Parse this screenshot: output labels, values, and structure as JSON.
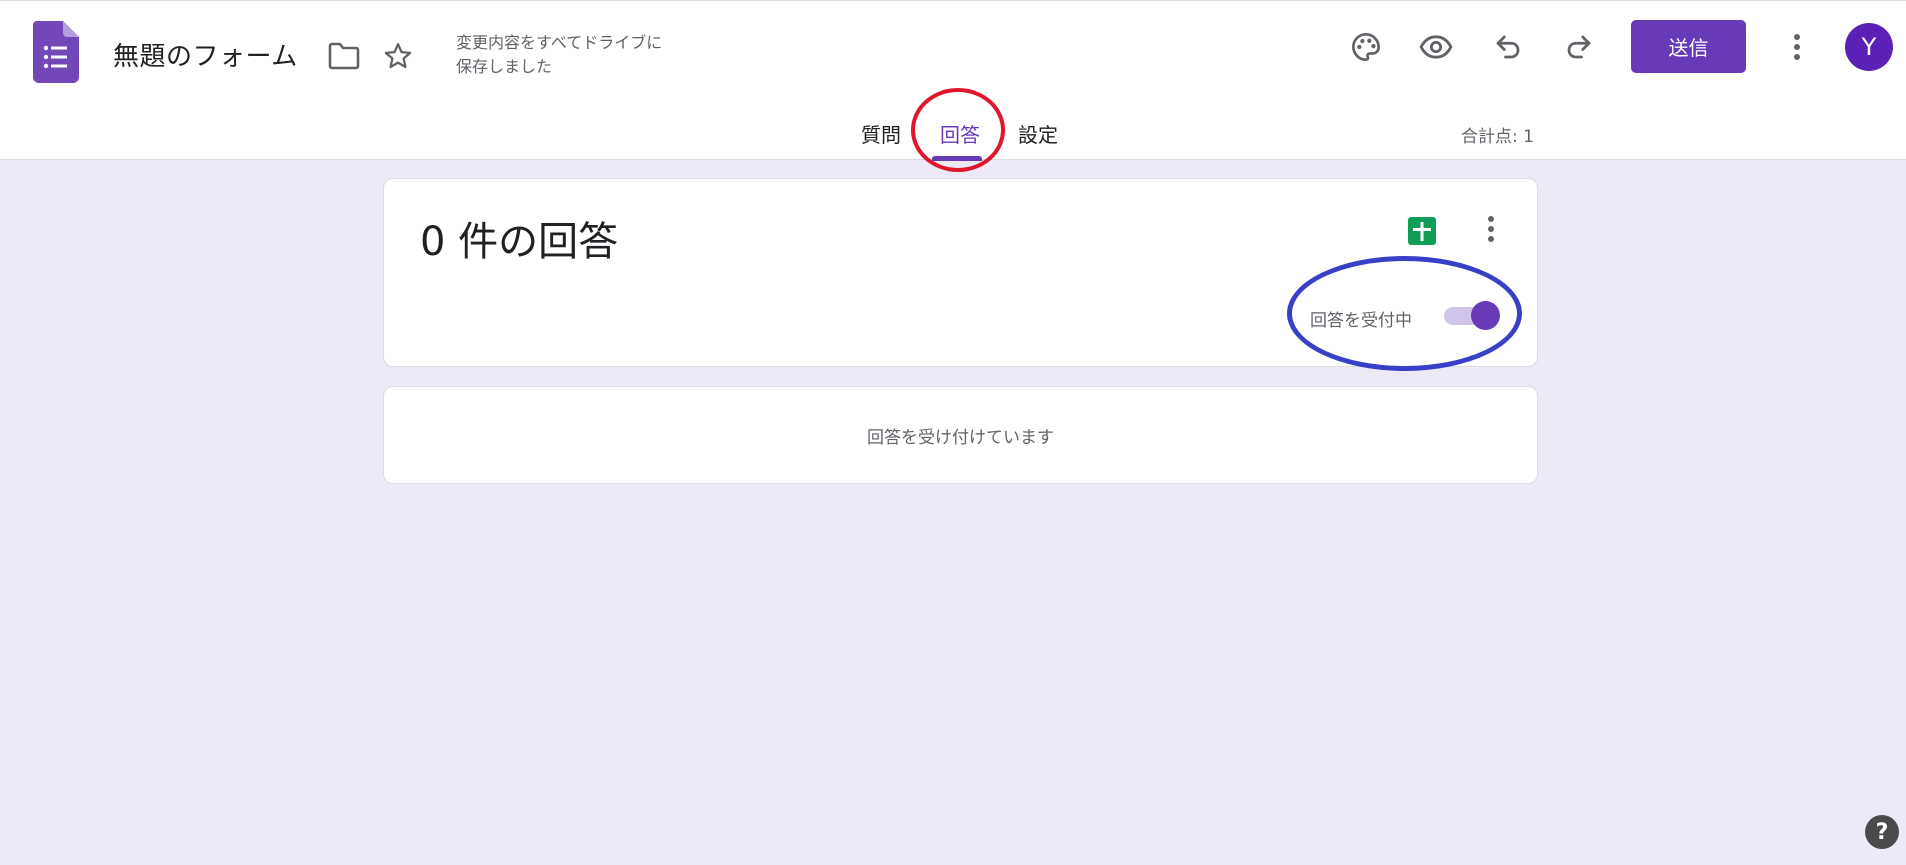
{
  "header": {
    "title": "無題のフォーム",
    "save_status_line1": "変更内容をすべてドライブに",
    "save_status_line2": "保存しました",
    "send_label": "送信",
    "avatar_initial": "Y",
    "icons": [
      "forms-logo-icon",
      "folder-icon",
      "star-icon",
      "palette-icon",
      "eye-icon",
      "undo-icon",
      "redo-icon",
      "more-vert-icon"
    ]
  },
  "tabs": {
    "questions": "質問",
    "responses": "回答",
    "settings": "設定",
    "active": "responses"
  },
  "total_points": "合計点: 1",
  "summary": {
    "response_count_text": "0 件の回答",
    "accepting_label": "回答を受付中",
    "accepting_on": true
  },
  "message": {
    "text": "回答を受け付けています"
  },
  "help_label": "?",
  "colors": {
    "accent": "#673ab7",
    "background": "#ede9f6",
    "sheets_green": "#0f9d58",
    "annotation_red": "#e0172a",
    "annotation_blue": "#3a3fc8"
  }
}
